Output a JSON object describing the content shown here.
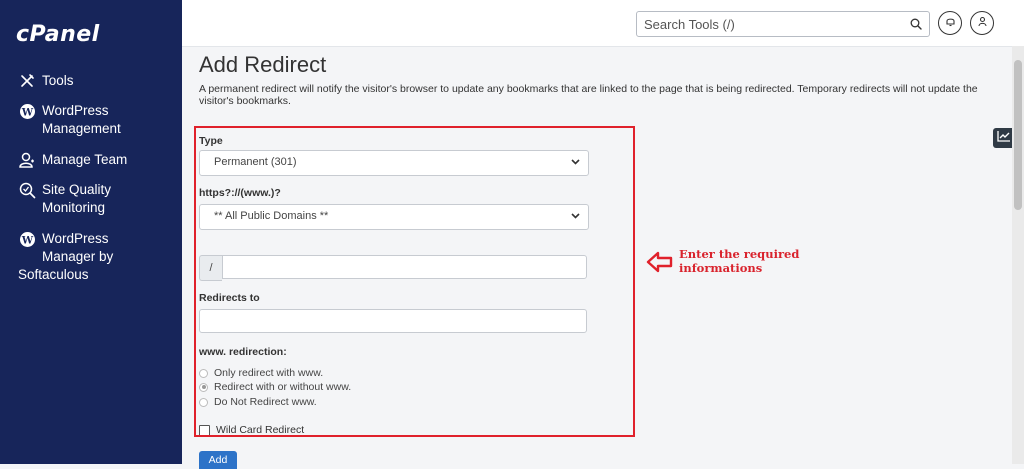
{
  "sidebar": {
    "logo": "cPanel",
    "items": [
      {
        "icon": "tools-icon",
        "line1": "Tools",
        "line2": ""
      },
      {
        "icon": "wordpress-icon",
        "line1": "WordPress",
        "line2": "Management"
      },
      {
        "icon": "manage-team-icon",
        "line1": "Manage Team",
        "line2": ""
      },
      {
        "icon": "site-quality-icon",
        "line1": "Site Quality",
        "line2": "Monitoring"
      },
      {
        "icon": "wordpress-icon",
        "line1": "WordPress",
        "line2": "Manager by",
        "line3": "Softaculous"
      }
    ]
  },
  "topbar": {
    "search_placeholder": "Search Tools (/)",
    "icons": [
      "search-icon",
      "bell-icon",
      "user-icon"
    ]
  },
  "page": {
    "title": "Add Redirect",
    "description": "A permanent redirect will notify the visitor's browser to update any bookmarks that are linked to the page that is being redirected. Temporary redirects will not update the visitor's bookmarks."
  },
  "form": {
    "type_label": "Type",
    "type_value": "Permanent (301)",
    "domain_label": "https?://(www.)?",
    "domain_value": "** All Public Domains **",
    "path_prefix": "/",
    "path_value": "",
    "redirects_to_label": "Redirects to",
    "redirects_to_value": "",
    "www_label": "www. redirection:",
    "www_options": [
      {
        "label": "Only redirect with www.",
        "checked": false
      },
      {
        "label": "Redirect with or without www.",
        "checked": true
      },
      {
        "label": "Do Not Redirect www.",
        "checked": false
      }
    ],
    "wildcard_label": "Wild Card Redirect",
    "wildcard_checked": false,
    "add_button": "Add"
  },
  "annotation": {
    "text": "Enter the required informations",
    "color": "#d9232d"
  },
  "colors": {
    "sidebar_bg": "#17255a",
    "highlight": "#e0212b",
    "primary_button": "#2d73c8"
  }
}
